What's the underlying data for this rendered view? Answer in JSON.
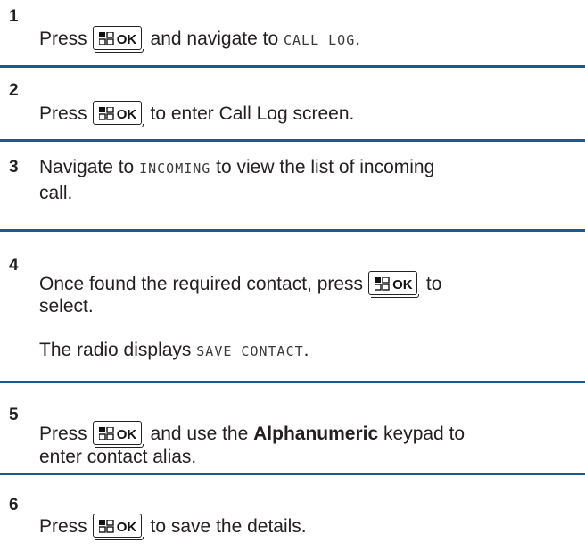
{
  "key": {
    "label": "OK",
    "icon": "menu-grid-icon"
  },
  "colors": {
    "separator": "#1b5a8f",
    "text": "#231f20"
  },
  "steps": [
    {
      "number": "1",
      "lines": [
        {
          "pre": "Press",
          "post": "and navigate to",
          "mono": "CALL LOG",
          "tail": "."
        }
      ]
    },
    {
      "number": "2",
      "lines": [
        {
          "pre": "Press",
          "post": "to enter Call Log screen."
        }
      ]
    },
    {
      "number": "3",
      "pre": "Navigate to",
      "mono": "INCOMING",
      "post": "to view the list of incoming",
      "line2": "call."
    },
    {
      "number": "4",
      "pre": "Once found the required contact, press",
      "post": "to",
      "line2": "select.",
      "note_pre": "The radio displays",
      "note_mono": "SAVE CONTACT",
      "note_tail": "."
    },
    {
      "number": "5",
      "pre": "Press",
      "post": "and use the",
      "bold": "Alphanumeric",
      "post2": "keypad to",
      "line2": "enter contact alias."
    },
    {
      "number": "6",
      "pre": "Press",
      "post": "to save the details."
    }
  ]
}
